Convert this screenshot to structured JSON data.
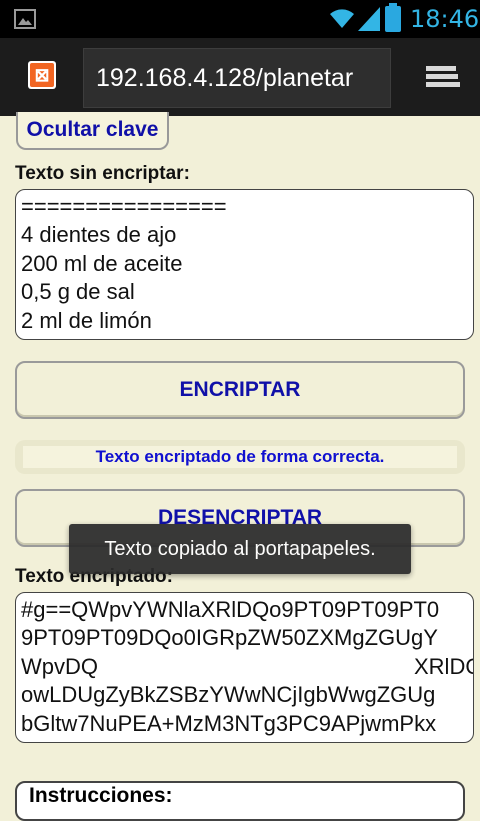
{
  "status_bar": {
    "time": "18:46",
    "icons": [
      "image-icon",
      "wifi-icon",
      "signal-icon",
      "battery-icon"
    ]
  },
  "browser": {
    "url": "192.168.4.128/planetar",
    "app_icon_label": "⊠"
  },
  "page": {
    "hide_key_button": "Ocultar clave",
    "plain_label": "Texto sin encriptar:",
    "plain_text_lines": [
      "================",
      "4 dientes de ajo",
      "200 ml de aceite",
      "0,5 g de sal",
      "2 ml de limón"
    ],
    "encrypt_button": "ENCRIPTAR",
    "status_message": "Texto encriptado de forma correcta.",
    "decrypt_button": "DESENCRIPTAR",
    "encrypted_label": "Texto encriptado:",
    "encrypted_text_lines": [
      "#g==QWpvYWNlaXRlDQo9PT09PT09PT0",
      "9PT09PT09DQo0IGRpZW50ZXMgZGUgY",
      "WpvDQ",
      "XRlDQ",
      "owLDUgZyBkZSBzYWwNCjIgbWwgZGUg",
      "bGltw7NuPEA+MzM3NTg3PC9APjwmPkx"
    ],
    "instructions_label": "Instrucciones:"
  },
  "toast": {
    "text": "Texto copiado al portapapeles."
  },
  "colors": {
    "accent_blue": "#1010a8",
    "status_blue": "#33b5e5",
    "background": "#f2f0d8"
  }
}
